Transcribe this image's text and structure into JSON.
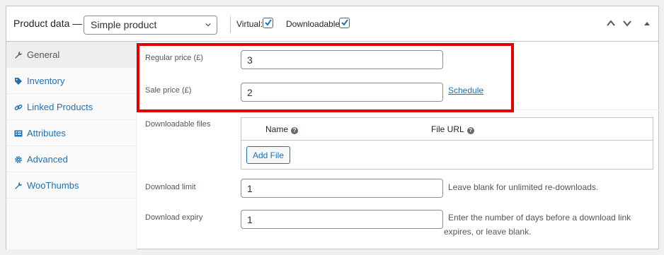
{
  "header": {
    "title": "Product data —",
    "product_type": "Simple product",
    "virtual_label": "Virtual:",
    "virtual_checked": true,
    "downloadable_label": "Downloadable:",
    "downloadable_checked": true
  },
  "tabs": [
    {
      "label": "General",
      "icon": "wrench-icon",
      "active": true
    },
    {
      "label": "Inventory",
      "icon": "tag-icon",
      "active": false
    },
    {
      "label": "Linked Products",
      "icon": "link-icon",
      "active": false
    },
    {
      "label": "Attributes",
      "icon": "list-icon",
      "active": false
    },
    {
      "label": "Advanced",
      "icon": "gear-icon",
      "active": false
    },
    {
      "label": "WooThumbs",
      "icon": "wrench-icon",
      "active": false
    }
  ],
  "general": {
    "regular_price_label": "Regular price (£)",
    "regular_price_value": "3",
    "sale_price_label": "Sale price (£)",
    "sale_price_value": "2",
    "schedule_link": "Schedule",
    "downloadable_files_label": "Downloadable files",
    "files_col_name": "Name",
    "files_col_url": "File URL",
    "add_file_button": "Add File",
    "download_limit_label": "Download limit",
    "download_limit_value": "1",
    "download_limit_desc": "Leave blank for unlimited re-downloads.",
    "download_expiry_label": "Download expiry",
    "download_expiry_value": "1",
    "download_expiry_desc_line1": "Enter the number of days before a download link",
    "download_expiry_desc_line2": "expires, or leave blank."
  },
  "colors": {
    "accent": "#2271b1",
    "highlight": "#e00000"
  }
}
